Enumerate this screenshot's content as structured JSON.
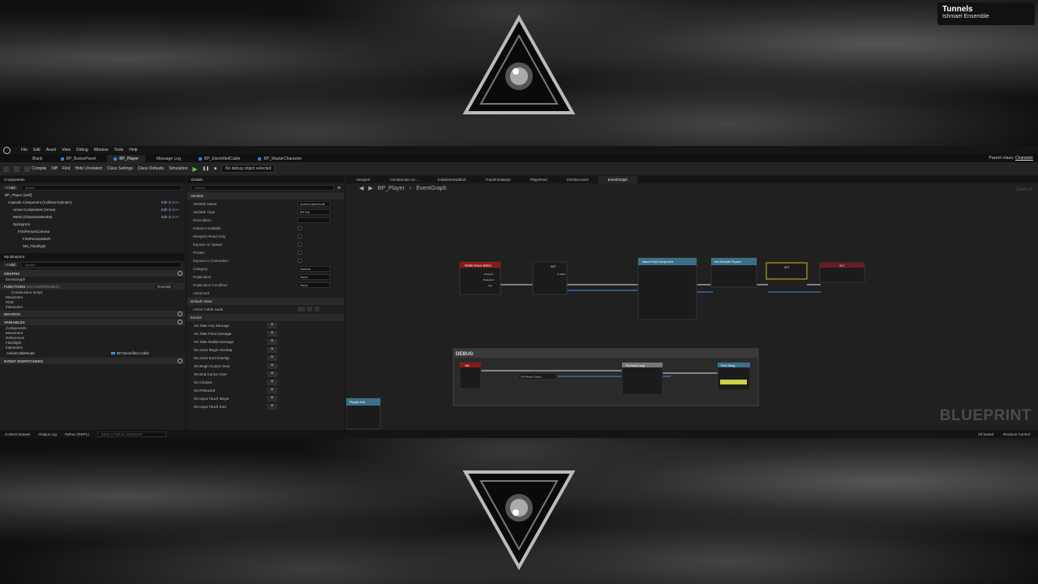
{
  "badge": {
    "title": "Tunnels",
    "artist": "Ishmael Ensemble"
  },
  "menu": [
    "File",
    "Edit",
    "Asset",
    "View",
    "Debug",
    "Window",
    "Tools",
    "Help"
  ],
  "tabs": [
    "Blank",
    "BP_ButtonPanel",
    "BP_Player",
    "Message Log",
    "BP_ElectrifiedCable",
    "BP_MasterCharacter"
  ],
  "parent_class": {
    "label": "Parent class:",
    "value": "Character"
  },
  "toolbar": {
    "compile": "Compile",
    "diff": "Diff",
    "find": "Find",
    "hide_unrelated": "Hide Unrelated",
    "class_settings": "Class Settings",
    "class_defaults": "Class Defaults",
    "simulation": "Simulation",
    "debug_object": "No debug object selected"
  },
  "components": {
    "title": "Components",
    "add": "+ Add",
    "search": "Search",
    "items": [
      {
        "label": "BP_Player (Self)",
        "edit": ""
      },
      {
        "label": "Capsule Component (CollisionCylinder)",
        "edit": "Edit in C++"
      },
      {
        "label": "Arrow Component (Arrow)",
        "edit": "Edit in C++"
      },
      {
        "label": "Mesh (CharacterMesh0)",
        "edit": "Edit in C++"
      },
      {
        "label": "SpringArm",
        "edit": ""
      },
      {
        "label": "FirstPersonCamera",
        "edit": ""
      },
      {
        "label": "FirstPersonMesh",
        "edit": ""
      },
      {
        "label": "SM_Flashlight",
        "edit": ""
      }
    ]
  },
  "my_blueprint": {
    "title": "My Blueprint",
    "add": "+ Add",
    "search": "Search",
    "graphs_label": "GRAPHS",
    "graphs": [
      "EventGraph"
    ],
    "functions_label": "FUNCTIONS",
    "functions_count": "(23 OVERRIDABLE)",
    "override": "Override",
    "functions": [
      "Construction Script",
      "Movement",
      "HUD",
      "Interaction"
    ],
    "macros_label": "MACROS",
    "variables_label": "VARIABLES",
    "variable_groups": [
      "Components",
      "Movement",
      "References",
      "Flashlight",
      "Interaction"
    ],
    "variable": {
      "name": "ActiveCableNode",
      "type": "BP Electrified Cable"
    },
    "dispatchers_label": "EVENT DISPATCHERS"
  },
  "details": {
    "title": "Details",
    "search": "Search",
    "variable_section": "Variable",
    "rows": [
      {
        "label": "Variable Name",
        "value": "ActiveCableNode",
        "kind": "text"
      },
      {
        "label": "Variable Type",
        "value": "BP Ele",
        "kind": "text"
      },
      {
        "label": "Description",
        "value": "",
        "kind": "text"
      },
      {
        "label": "Instance Editable",
        "value": "",
        "kind": "check"
      },
      {
        "label": "Blueprint Read Only",
        "value": "",
        "kind": "check"
      },
      {
        "label": "Expose on Spawn",
        "value": "",
        "kind": "check"
      },
      {
        "label": "Private",
        "value": "",
        "kind": "check"
      },
      {
        "label": "Expose to Cinematics",
        "value": "",
        "kind": "check"
      },
      {
        "label": "Category",
        "value": "Default",
        "kind": "text"
      },
      {
        "label": "Replication",
        "value": "None",
        "kind": "text"
      },
      {
        "label": "Replication Condition",
        "value": "None",
        "kind": "text"
      }
    ],
    "advanced": "Advanced",
    "default_section": "Default Value",
    "default_row": "Active Cable Node",
    "events_section": "Events",
    "events": [
      "On Take Any Damage",
      "On Take Point Damage",
      "On Take Radial Damage",
      "On Actor Begin Overlap",
      "On Actor End Overlap",
      "On Begin Cursor Over",
      "On End Cursor Over",
      "On Clicked",
      "On Released",
      "On Input Touch Begin",
      "On Input Touch End"
    ]
  },
  "graph": {
    "tabs": [
      "Viewport",
      "Construction Sc...",
      "InitializeHeadbob",
      "TraceFootsteps",
      "PlayerHud",
      "CheckCrouch",
      "EventGraph"
    ],
    "breadcrumb": [
      "BP_Player",
      "EventGraph"
    ],
    "zoom": "Zoom -3",
    "watermark": "BLUEPRINT",
    "debug_comment": "DEBUG",
    "nodes": {
      "middle_mouse": "Middle Mouse Button",
      "pressed": "Pressed",
      "released": "Released",
      "key": "Key",
      "set1": "SET",
      "is_valid": "Is Valid",
      "attach": "Attach Point Component",
      "set_sim": "Set Simulate Physics",
      "set2": "SET",
      "set3": "SET",
      "tab_key": "Tab",
      "for_each": "For Each Loop",
      "print": "Print String",
      "get_physics": "Get Physics Object",
      "physics_handle": "Physics Hull"
    }
  },
  "statusbar": {
    "content_drawer": "Content Drawer",
    "output_log": "Output Log",
    "cmd": "Python (REPL)",
    "cmd_placeholder": "Enter a Python statement",
    "saved": "All Saved",
    "revision": "Revision Control"
  }
}
